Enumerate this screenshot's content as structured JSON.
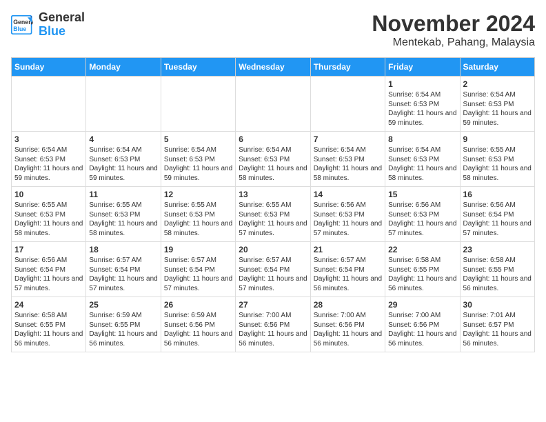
{
  "logo": {
    "line1": "General",
    "line2": "Blue"
  },
  "title": "November 2024",
  "subtitle": "Mentekab, Pahang, Malaysia",
  "weekdays": [
    "Sunday",
    "Monday",
    "Tuesday",
    "Wednesday",
    "Thursday",
    "Friday",
    "Saturday"
  ],
  "weeks": [
    [
      {
        "day": "",
        "sunrise": "",
        "sunset": "",
        "daylight": ""
      },
      {
        "day": "",
        "sunrise": "",
        "sunset": "",
        "daylight": ""
      },
      {
        "day": "",
        "sunrise": "",
        "sunset": "",
        "daylight": ""
      },
      {
        "day": "",
        "sunrise": "",
        "sunset": "",
        "daylight": ""
      },
      {
        "day": "",
        "sunrise": "",
        "sunset": "",
        "daylight": ""
      },
      {
        "day": "1",
        "sunrise": "Sunrise: 6:54 AM",
        "sunset": "Sunset: 6:53 PM",
        "daylight": "Daylight: 11 hours and 59 minutes."
      },
      {
        "day": "2",
        "sunrise": "Sunrise: 6:54 AM",
        "sunset": "Sunset: 6:53 PM",
        "daylight": "Daylight: 11 hours and 59 minutes."
      }
    ],
    [
      {
        "day": "3",
        "sunrise": "Sunrise: 6:54 AM",
        "sunset": "Sunset: 6:53 PM",
        "daylight": "Daylight: 11 hours and 59 minutes."
      },
      {
        "day": "4",
        "sunrise": "Sunrise: 6:54 AM",
        "sunset": "Sunset: 6:53 PM",
        "daylight": "Daylight: 11 hours and 59 minutes."
      },
      {
        "day": "5",
        "sunrise": "Sunrise: 6:54 AM",
        "sunset": "Sunset: 6:53 PM",
        "daylight": "Daylight: 11 hours and 59 minutes."
      },
      {
        "day": "6",
        "sunrise": "Sunrise: 6:54 AM",
        "sunset": "Sunset: 6:53 PM",
        "daylight": "Daylight: 11 hours and 58 minutes."
      },
      {
        "day": "7",
        "sunrise": "Sunrise: 6:54 AM",
        "sunset": "Sunset: 6:53 PM",
        "daylight": "Daylight: 11 hours and 58 minutes."
      },
      {
        "day": "8",
        "sunrise": "Sunrise: 6:54 AM",
        "sunset": "Sunset: 6:53 PM",
        "daylight": "Daylight: 11 hours and 58 minutes."
      },
      {
        "day": "9",
        "sunrise": "Sunrise: 6:55 AM",
        "sunset": "Sunset: 6:53 PM",
        "daylight": "Daylight: 11 hours and 58 minutes."
      }
    ],
    [
      {
        "day": "10",
        "sunrise": "Sunrise: 6:55 AM",
        "sunset": "Sunset: 6:53 PM",
        "daylight": "Daylight: 11 hours and 58 minutes."
      },
      {
        "day": "11",
        "sunrise": "Sunrise: 6:55 AM",
        "sunset": "Sunset: 6:53 PM",
        "daylight": "Daylight: 11 hours and 58 minutes."
      },
      {
        "day": "12",
        "sunrise": "Sunrise: 6:55 AM",
        "sunset": "Sunset: 6:53 PM",
        "daylight": "Daylight: 11 hours and 58 minutes."
      },
      {
        "day": "13",
        "sunrise": "Sunrise: 6:55 AM",
        "sunset": "Sunset: 6:53 PM",
        "daylight": "Daylight: 11 hours and 57 minutes."
      },
      {
        "day": "14",
        "sunrise": "Sunrise: 6:56 AM",
        "sunset": "Sunset: 6:53 PM",
        "daylight": "Daylight: 11 hours and 57 minutes."
      },
      {
        "day": "15",
        "sunrise": "Sunrise: 6:56 AM",
        "sunset": "Sunset: 6:53 PM",
        "daylight": "Daylight: 11 hours and 57 minutes."
      },
      {
        "day": "16",
        "sunrise": "Sunrise: 6:56 AM",
        "sunset": "Sunset: 6:54 PM",
        "daylight": "Daylight: 11 hours and 57 minutes."
      }
    ],
    [
      {
        "day": "17",
        "sunrise": "Sunrise: 6:56 AM",
        "sunset": "Sunset: 6:54 PM",
        "daylight": "Daylight: 11 hours and 57 minutes."
      },
      {
        "day": "18",
        "sunrise": "Sunrise: 6:57 AM",
        "sunset": "Sunset: 6:54 PM",
        "daylight": "Daylight: 11 hours and 57 minutes."
      },
      {
        "day": "19",
        "sunrise": "Sunrise: 6:57 AM",
        "sunset": "Sunset: 6:54 PM",
        "daylight": "Daylight: 11 hours and 57 minutes."
      },
      {
        "day": "20",
        "sunrise": "Sunrise: 6:57 AM",
        "sunset": "Sunset: 6:54 PM",
        "daylight": "Daylight: 11 hours and 57 minutes."
      },
      {
        "day": "21",
        "sunrise": "Sunrise: 6:57 AM",
        "sunset": "Sunset: 6:54 PM",
        "daylight": "Daylight: 11 hours and 56 minutes."
      },
      {
        "day": "22",
        "sunrise": "Sunrise: 6:58 AM",
        "sunset": "Sunset: 6:55 PM",
        "daylight": "Daylight: 11 hours and 56 minutes."
      },
      {
        "day": "23",
        "sunrise": "Sunrise: 6:58 AM",
        "sunset": "Sunset: 6:55 PM",
        "daylight": "Daylight: 11 hours and 56 minutes."
      }
    ],
    [
      {
        "day": "24",
        "sunrise": "Sunrise: 6:58 AM",
        "sunset": "Sunset: 6:55 PM",
        "daylight": "Daylight: 11 hours and 56 minutes."
      },
      {
        "day": "25",
        "sunrise": "Sunrise: 6:59 AM",
        "sunset": "Sunset: 6:55 PM",
        "daylight": "Daylight: 11 hours and 56 minutes."
      },
      {
        "day": "26",
        "sunrise": "Sunrise: 6:59 AM",
        "sunset": "Sunset: 6:56 PM",
        "daylight": "Daylight: 11 hours and 56 minutes."
      },
      {
        "day": "27",
        "sunrise": "Sunrise: 7:00 AM",
        "sunset": "Sunset: 6:56 PM",
        "daylight": "Daylight: 11 hours and 56 minutes."
      },
      {
        "day": "28",
        "sunrise": "Sunrise: 7:00 AM",
        "sunset": "Sunset: 6:56 PM",
        "daylight": "Daylight: 11 hours and 56 minutes."
      },
      {
        "day": "29",
        "sunrise": "Sunrise: 7:00 AM",
        "sunset": "Sunset: 6:56 PM",
        "daylight": "Daylight: 11 hours and 56 minutes."
      },
      {
        "day": "30",
        "sunrise": "Sunrise: 7:01 AM",
        "sunset": "Sunset: 6:57 PM",
        "daylight": "Daylight: 11 hours and 56 minutes."
      }
    ]
  ]
}
